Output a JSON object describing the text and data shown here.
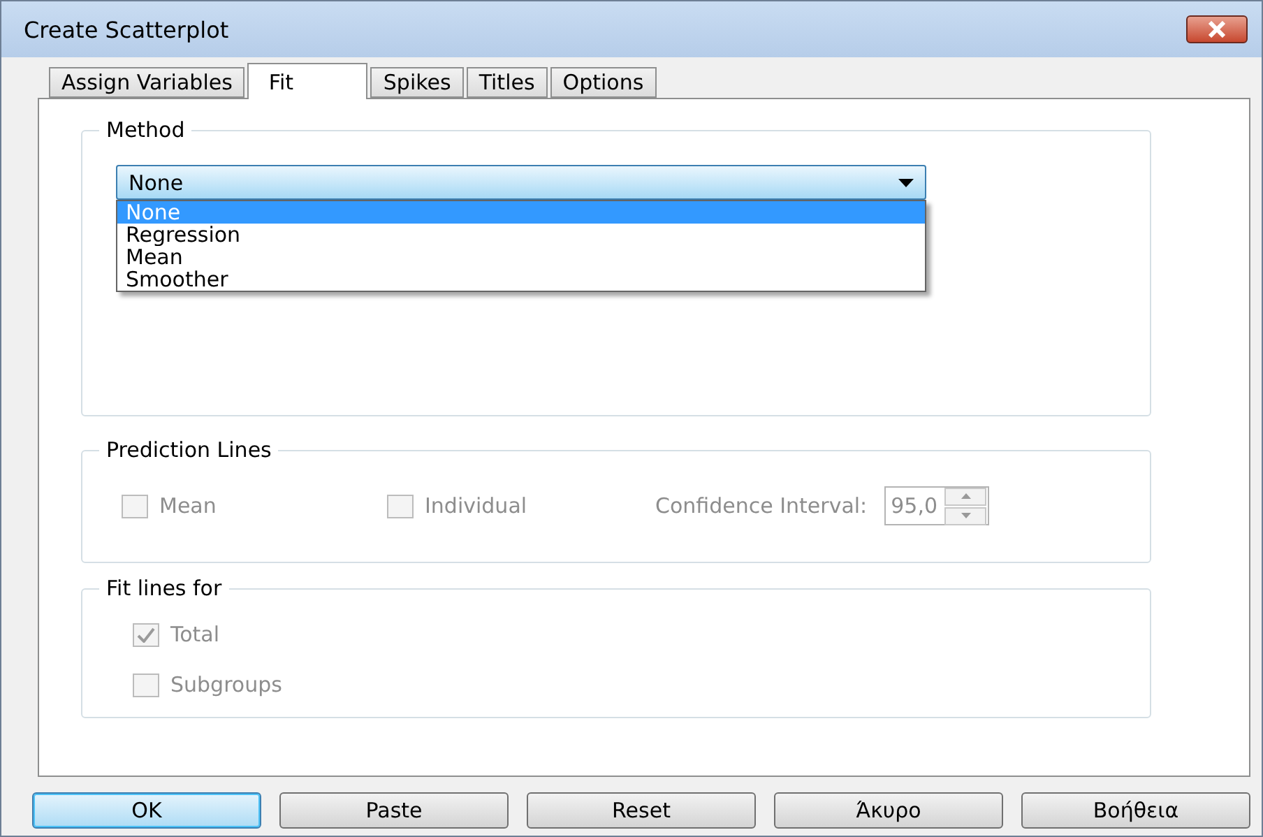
{
  "window": {
    "title": "Create Scatterplot"
  },
  "tabs": [
    {
      "label": "Assign Variables",
      "selected": false
    },
    {
      "label": "Fit",
      "selected": true
    },
    {
      "label": "Spikes",
      "selected": false
    },
    {
      "label": "Titles",
      "selected": false
    },
    {
      "label": "Options",
      "selected": false
    }
  ],
  "method": {
    "title": "Method",
    "value": "None",
    "expanded": true,
    "options": [
      {
        "label": "None",
        "selected": true
      },
      {
        "label": "Regression",
        "selected": false
      },
      {
        "label": "Mean",
        "selected": false
      },
      {
        "label": "Smoother",
        "selected": false
      }
    ]
  },
  "prediction_lines": {
    "title": "Prediction Lines",
    "disabled": true,
    "checkboxes": [
      {
        "label": "Mean",
        "checked": false
      },
      {
        "label": "Individual",
        "checked": false
      }
    ],
    "confidence_label": "Confidence Interval:",
    "confidence_value": "95,0"
  },
  "fit_lines_for": {
    "title": "Fit lines for",
    "disabled": true,
    "checkboxes": [
      {
        "label": "Total",
        "checked": true
      },
      {
        "label": "Subgroups",
        "checked": false
      }
    ]
  },
  "buttons": [
    {
      "label": "OK",
      "default": true
    },
    {
      "label": "Paste",
      "default": false
    },
    {
      "label": "Reset",
      "default": false
    },
    {
      "label": "Άκυρο",
      "default": false
    },
    {
      "label": "Βοήθεια",
      "default": false
    }
  ]
}
